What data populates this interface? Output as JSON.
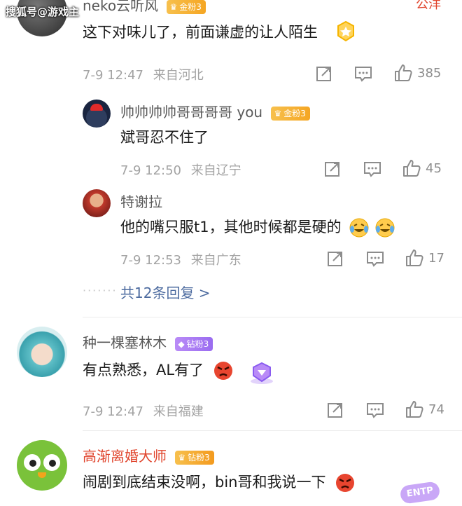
{
  "watermark": "搜狐号@游戏主",
  "comments": [
    {
      "username": "neko云听风",
      "badge": "金粉3",
      "text": "这下对味儿了，前面谦虚的让人陌生",
      "time": "7-9 12:47",
      "location": "来自河北",
      "likes": "385"
    },
    {
      "username": "帅帅帅帅哥哥哥哥 you",
      "badge": "金粉3",
      "text": "斌哥忍不住了",
      "time": "7-9 12:50",
      "location": "来自辽宁",
      "likes": "45"
    },
    {
      "username": "特谢拉",
      "badge": "",
      "text": "他的嘴只服t1，其他时候都是硬的",
      "time": "7-9 12:53",
      "location": "来自广东",
      "likes": "17"
    },
    {
      "username": "种一棵塞林木",
      "badge": "钻粉3",
      "text": "有点熟悉，AL有了",
      "time": "7-9 12:47",
      "location": "来自福建",
      "likes": "74"
    },
    {
      "username": "高渐离婚大师",
      "badge": "钻粉3",
      "text": "闹剧到底结束没啊，bin哥和我说一下",
      "time": "",
      "location": "",
      "likes": ""
    }
  ],
  "replies_more": "共12条回复 >",
  "top_right_partial": "公洋",
  "sticker_text": "ENTP",
  "colors": {
    "accent_link": "#4e6ca0",
    "gold_badge": "#f5a623",
    "diamond_badge": "#9a6cf0"
  }
}
